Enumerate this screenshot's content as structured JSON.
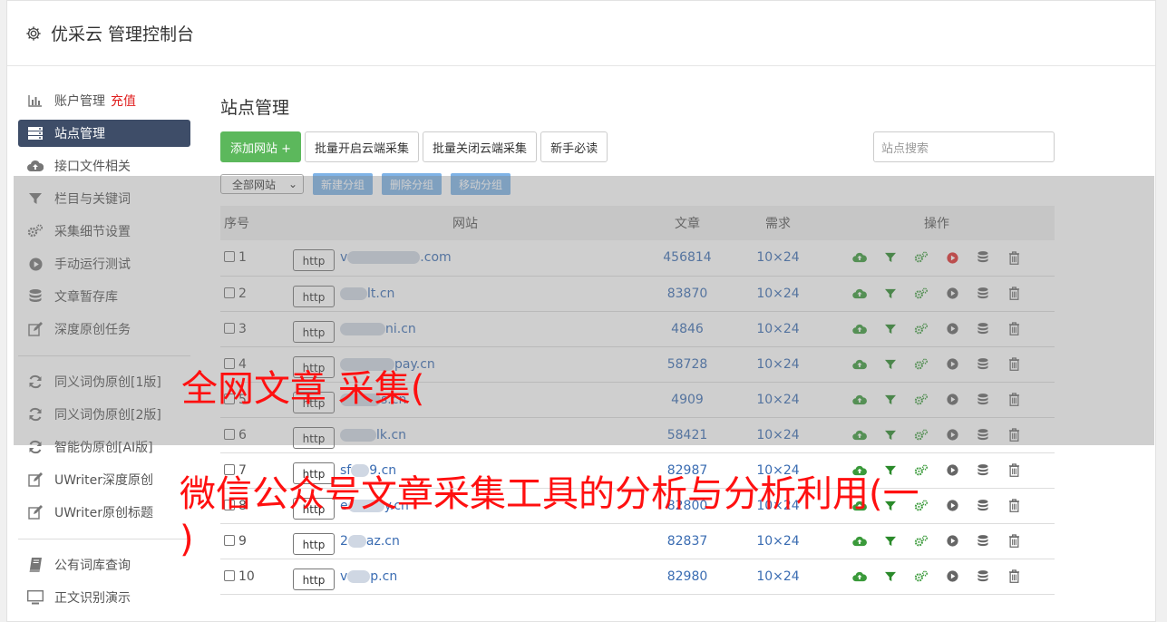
{
  "header": {
    "title": "优采云 管理控制台"
  },
  "sidebar": {
    "group1": [
      {
        "label": "账户管理",
        "tag": "充值",
        "icon": "bar-chart-icon",
        "active": false
      },
      {
        "label": "站点管理",
        "tag": "",
        "icon": "server-icon",
        "active": true
      },
      {
        "label": "接口文件相关",
        "tag": "",
        "icon": "cloud-upload-icon",
        "active": false
      },
      {
        "label": "栏目与关键词",
        "tag": "",
        "icon": "filter-icon",
        "active": false
      },
      {
        "label": "采集细节设置",
        "tag": "",
        "icon": "gears-icon",
        "active": false
      },
      {
        "label": "手动运行测试",
        "tag": "",
        "icon": "play-circle-icon",
        "active": false
      },
      {
        "label": "文章暂存库",
        "tag": "",
        "icon": "database-icon",
        "active": false
      },
      {
        "label": "深度原创任务",
        "tag": "",
        "icon": "edit-icon",
        "active": false
      }
    ],
    "group2": [
      {
        "label": "同义词伪原创[1版]",
        "icon": "refresh-icon"
      },
      {
        "label": "同义词伪原创[2版]",
        "icon": "refresh-icon"
      },
      {
        "label": "智能伪原创[AI版]",
        "icon": "refresh-icon"
      },
      {
        "label": "UWriter深度原创",
        "icon": "edit-icon"
      },
      {
        "label": "UWriter原创标题",
        "icon": "edit-icon"
      }
    ],
    "group3": [
      {
        "label": "公有词库查询",
        "icon": "book-icon"
      },
      {
        "label": "正文识别演示",
        "icon": "monitor-icon"
      }
    ]
  },
  "main": {
    "title": "站点管理",
    "toolbar": {
      "add": "添加网站 +",
      "batch_open": "批量开启云端采集",
      "batch_close": "批量关闭云端采集",
      "guide": "新手必读",
      "search_placeholder": "站点搜索"
    },
    "filter": {
      "select": "全部网站",
      "new_group": "新建分组",
      "delete_group": "删除分组",
      "move_group": "移动分组"
    },
    "table": {
      "headers": [
        "序号",
        "网站",
        "文章",
        "需求",
        "操作"
      ],
      "http_label": "http",
      "rows": [
        {
          "no": "1",
          "pre": "v",
          "post": ".com",
          "articles": "456814",
          "demand": "10×24",
          "running": true
        },
        {
          "no": "2",
          "pre": "",
          "post": "lt.cn",
          "articles": "83870",
          "demand": "10×24",
          "running": false
        },
        {
          "no": "3",
          "pre": "",
          "post": "ni.cn",
          "articles": "4846",
          "demand": "10×24",
          "running": false
        },
        {
          "no": "4",
          "pre": "",
          "post": "pay.cn",
          "articles": "58728",
          "demand": "10×24",
          "running": false
        },
        {
          "no": "5",
          "pre": "",
          "post": "s.cn",
          "articles": "4909",
          "demand": "10×24",
          "running": false
        },
        {
          "no": "6",
          "pre": "",
          "post": "lk.cn",
          "articles": "58421",
          "demand": "10×24",
          "running": false
        },
        {
          "no": "7",
          "pre": "sf",
          "post": "9.cn",
          "articles": "82987",
          "demand": "10×24",
          "running": false
        },
        {
          "no": "8",
          "pre": "e",
          "post": "y.cn",
          "articles": "82800",
          "demand": "10×24",
          "running": false
        },
        {
          "no": "9",
          "pre": "2",
          "post": "az.cn",
          "articles": "82837",
          "demand": "10×24",
          "running": false
        },
        {
          "no": "10",
          "pre": "v",
          "post": "p.cn",
          "articles": "82980",
          "demand": "10×24",
          "running": false
        }
      ]
    }
  },
  "watermark": {
    "line1": "全网文章 采集(",
    "line2": "微信公众号文章采集工具的分析与分析利用(一",
    "line3": ")"
  },
  "colors": {
    "accent": "#3e4d68",
    "green": "#5cb85c",
    "link": "#3a6cb2",
    "watermark": "#ff1010",
    "run_red": "#e03030"
  }
}
